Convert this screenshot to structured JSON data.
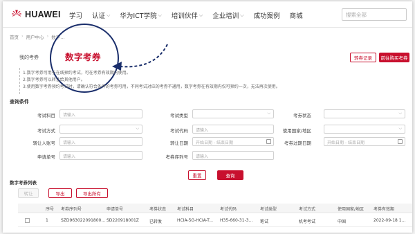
{
  "nav": {
    "logo_text": "HUAWEI",
    "items": [
      {
        "label": "学习",
        "has_dropdown": false
      },
      {
        "label": "认证",
        "has_dropdown": true
      },
      {
        "label": "华为ICT学院",
        "has_dropdown": true
      },
      {
        "label": "培训伙伴",
        "has_dropdown": true
      },
      {
        "label": "企业培训",
        "has_dropdown": true
      },
      {
        "label": "成功案例",
        "has_dropdown": false
      },
      {
        "label": "商城",
        "has_dropdown": false
      }
    ],
    "search_placeholder": "搜索全部"
  },
  "breadcrumb": [
    "首页",
    "用户中心",
    "数字..."
  ],
  "page": {
    "label": "我的考券",
    "title": "数字考券",
    "btn_records": "转券记录",
    "btn_buy": "前往购买考券"
  },
  "notes": [
    "1.数字考券可用于在线预约考试，可在考券有效期内使用。",
    "2.数字考券可以转让给其他用户。",
    "3.使用数字考券预约考试时，请确认符合条件的考券可用，不同考试对应的考券不通用，数字考券在有效期内仅可预约一次，无法再次使用。"
  ],
  "query": {
    "section_title": "查询条件",
    "fields": [
      {
        "label": "考试科目",
        "placeholder": "请输入",
        "type": "text"
      },
      {
        "label": "考试类型",
        "placeholder": "",
        "type": "select"
      },
      {
        "label": "考券状态",
        "placeholder": "",
        "type": "select"
      },
      {
        "label": "考试方式",
        "placeholder": "",
        "type": "select"
      },
      {
        "label": "考试代码",
        "placeholder": "请输入",
        "type": "text"
      },
      {
        "label": "使用国家/地区",
        "placeholder": "",
        "type": "select"
      },
      {
        "label": "转让人账号",
        "placeholder": "请输入",
        "type": "text"
      },
      {
        "label": "转让日期",
        "placeholder": "开始日期 - 结束日期",
        "type": "date"
      },
      {
        "label": "考券过期日期",
        "placeholder": "开始日期 - 结束日期",
        "type": "date"
      },
      {
        "label": "申请单号",
        "placeholder": "请输入",
        "type": "text"
      },
      {
        "label": "考券序列号",
        "placeholder": "请输入",
        "type": "text"
      }
    ],
    "btn_reset": "重置",
    "btn_query": "查询"
  },
  "list": {
    "title": "数字考券列表",
    "btn_transfer": "转让",
    "btn_export": "导出",
    "btn_export_all": "导出所有",
    "columns": [
      "序号",
      "考券序列号",
      "申请单号",
      "考券状态",
      "考试科目",
      "考试代码",
      "考试类型",
      "考试方式",
      "使用国家/地区",
      "考券有效期"
    ],
    "rows": [
      [
        "1",
        "SZD963022091800...",
        "SD220918001Z",
        "已转发",
        "HCIA-5G-HCIA-T...",
        "H35-660-31-3...",
        "笔试",
        "机考考试",
        "中国",
        "2022-09-18 1..."
      ]
    ]
  }
}
